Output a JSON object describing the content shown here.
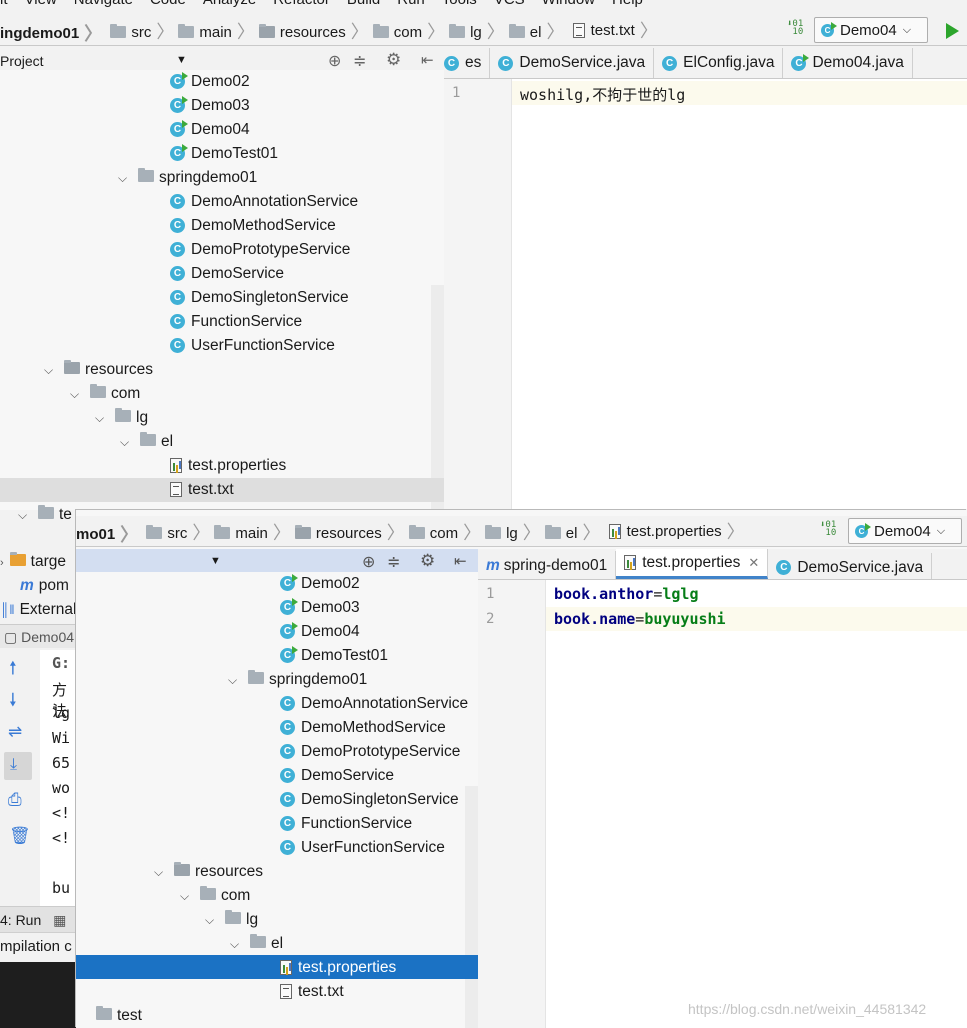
{
  "menubar": {
    "items": [
      "it",
      "View",
      "Navigate",
      "Code",
      "Analyze",
      "Refactor",
      "Build",
      "Run",
      "Tools",
      "VCS",
      "Window",
      "Help"
    ]
  },
  "top_window": {
    "breadcrumb": {
      "project": "ingdemo01",
      "path": [
        "src",
        "main",
        "resources",
        "com",
        "lg",
        "el"
      ],
      "file": "test.txt"
    },
    "run_config": "Demo04",
    "project_header": "Project",
    "tabs": [
      {
        "label": "es",
        "icon": "class-icon"
      },
      {
        "label": "DemoService.java",
        "icon": "class-icon"
      },
      {
        "label": "ElConfig.java",
        "icon": "class-icon"
      },
      {
        "label": "Demo04.java",
        "icon": "run-class-icon"
      }
    ],
    "tree": [
      {
        "label": "Demo02",
        "type": "run-class"
      },
      {
        "label": "Demo03",
        "type": "run-class"
      },
      {
        "label": "Demo04",
        "type": "run-class"
      },
      {
        "label": "DemoTest01",
        "type": "run-class"
      },
      {
        "label": "springdemo01",
        "type": "package"
      },
      {
        "label": "DemoAnnotationService",
        "type": "class"
      },
      {
        "label": "DemoMethodService",
        "type": "class"
      },
      {
        "label": "DemoPrototypeService",
        "type": "class"
      },
      {
        "label": "DemoService",
        "type": "class"
      },
      {
        "label": "DemoSingletonService",
        "type": "class"
      },
      {
        "label": "FunctionService",
        "type": "class"
      },
      {
        "label": "UserFunctionService",
        "type": "class"
      },
      {
        "label": "resources",
        "type": "resfolder"
      },
      {
        "label": "com",
        "type": "package"
      },
      {
        "label": "lg",
        "type": "package"
      },
      {
        "label": "el",
        "type": "package"
      },
      {
        "label": "test.properties",
        "type": "properties"
      },
      {
        "label": "test.txt",
        "type": "txt"
      },
      {
        "label": "te",
        "type": "folder"
      }
    ],
    "editor_lines": [
      {
        "num": "1",
        "text": "woshilg,不拘于世的lg"
      }
    ]
  },
  "left_strip": {
    "items": [
      "targe",
      "pom",
      "External"
    ],
    "console_tab": "Demo04",
    "console_lines": [
      "G:",
      "方法",
      "lg",
      "Wi",
      "65",
      "wo",
      "<!",
      "<!",
      "",
      "bu"
    ],
    "run_tab": "4: Run",
    "status": "mpilation c"
  },
  "bottom_window": {
    "breadcrumb": {
      "project": "mo01",
      "path": [
        "src",
        "main",
        "resources",
        "com",
        "lg",
        "el"
      ],
      "file": "test.properties"
    },
    "run_config": "Demo04",
    "tabs": [
      {
        "label": "spring-demo01",
        "icon": "maven-icon"
      },
      {
        "label": "test.properties",
        "icon": "properties-icon",
        "closable": true
      },
      {
        "label": "DemoService.java",
        "icon": "class-icon"
      }
    ],
    "tree": [
      {
        "label": "Demo02",
        "type": "run-class"
      },
      {
        "label": "Demo03",
        "type": "run-class"
      },
      {
        "label": "Demo04",
        "type": "run-class"
      },
      {
        "label": "DemoTest01",
        "type": "run-class"
      },
      {
        "label": "springdemo01",
        "type": "package"
      },
      {
        "label": "DemoAnnotationService",
        "type": "class"
      },
      {
        "label": "DemoMethodService",
        "type": "class"
      },
      {
        "label": "DemoPrototypeService",
        "type": "class"
      },
      {
        "label": "DemoService",
        "type": "class"
      },
      {
        "label": "DemoSingletonService",
        "type": "class"
      },
      {
        "label": "FunctionService",
        "type": "class"
      },
      {
        "label": "UserFunctionService",
        "type": "class"
      },
      {
        "label": "resources",
        "type": "resfolder"
      },
      {
        "label": "com",
        "type": "package"
      },
      {
        "label": "lg",
        "type": "package"
      },
      {
        "label": "el",
        "type": "package"
      },
      {
        "label": "test.properties",
        "type": "properties"
      },
      {
        "label": "test.txt",
        "type": "txt"
      },
      {
        "label": "test",
        "type": "folder"
      }
    ],
    "editor_lines": [
      {
        "num": "1",
        "key": "book.anthor",
        "eq": "=",
        "value": "lglg"
      },
      {
        "num": "2",
        "key": "book.name",
        "eq": "=",
        "value": "buyuyushi"
      }
    ]
  },
  "watermark": "https://blog.csdn.net/weixin_44581342",
  "colors": {
    "accent": "#4083c9",
    "selection": "#1b72c4",
    "class_icon": "#3fb0d6",
    "run": "#2ca52c",
    "prop_key": "#000080",
    "prop_value": "#067d17"
  }
}
